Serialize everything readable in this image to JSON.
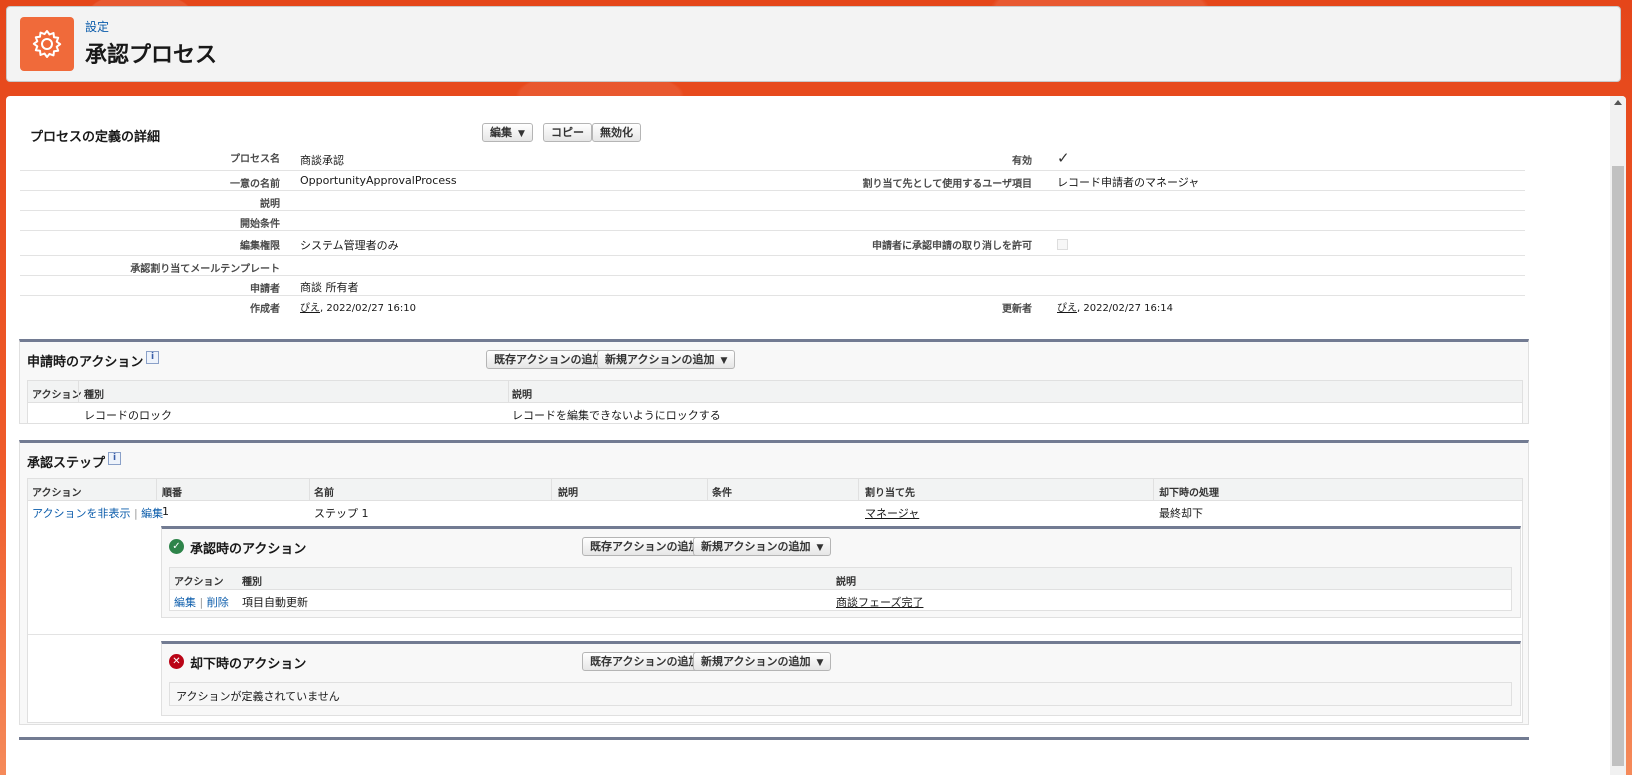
{
  "header": {
    "breadcrumb": "設定",
    "title": "承認プロセス",
    "icon": "gear-icon",
    "icon_color": "#f06a3a"
  },
  "detail": {
    "title": "プロセスの定義の詳細",
    "buttons": {
      "edit": "編集",
      "copy": "コピー",
      "deactivate": "無効化"
    },
    "rows": [
      {
        "label": "プロセス名",
        "value": "商談承認",
        "label2": "有効",
        "value2": "✓"
      },
      {
        "label": "一意の名前",
        "value": "OpportunityApprovalProcess",
        "label2": "割り当て先として使用するユーザ項目",
        "value2": "レコード申請者のマネージャ"
      },
      {
        "label": "説明",
        "value": ""
      },
      {
        "label": "開始条件",
        "value": ""
      },
      {
        "label": "編集権限",
        "value": "システム管理者のみ",
        "label2": "申請者に承認申請の取り消しを許可",
        "value2": ""
      },
      {
        "label": "承認割り当てメールテンプレート",
        "value": ""
      },
      {
        "label": "申請者",
        "value": "商談 所有者"
      },
      {
        "label": "作成者",
        "user": "ぴえ",
        "date": ", 2022/02/27 16:10",
        "label2": "更新者",
        "user2": "ぴえ",
        "date2": ", 2022/02/27 16:14"
      }
    ]
  },
  "submission_actions": {
    "title": "申請時のアクション",
    "btn_existing": "既存アクションの追加",
    "btn_new": "新規アクションの追加",
    "columns": [
      "アクション",
      "種別",
      "説明"
    ],
    "rows": [
      {
        "action": "",
        "type": "レコードのロック",
        "description": "レコードを編集できないようにロックする"
      }
    ]
  },
  "approval_steps": {
    "title": "承認ステップ",
    "columns": [
      "アクション",
      "順番",
      "名前",
      "説明",
      "条件",
      "割り当て先",
      "却下時の処理"
    ],
    "row": {
      "action_hide": "アクションを非表示",
      "action_edit": "編集",
      "order": "1",
      "name": "ステップ 1",
      "description": "",
      "criteria": "",
      "assignee": "マネージャ",
      "reject": "最終却下"
    },
    "approval_actions": {
      "title": "承認時のアクション",
      "btn_existing": "既存アクションの追加",
      "btn_new": "新規アクションの追加",
      "columns": [
        "アクション",
        "種別",
        "説明"
      ],
      "row": {
        "edit": "編集",
        "delete": "削除",
        "type": "項目自動更新",
        "description": "商談フェーズ完了"
      }
    },
    "rejection_actions": {
      "title": "却下時のアクション",
      "btn_existing": "既存アクションの追加",
      "btn_new": "新規アクションの追加",
      "empty": "アクションが定義されていません"
    }
  },
  "colors": {
    "accent": "#e8491d",
    "link": "#0b5cab",
    "section_border": "#727b92",
    "approve": "#2e844a",
    "reject": "#ba0517"
  }
}
